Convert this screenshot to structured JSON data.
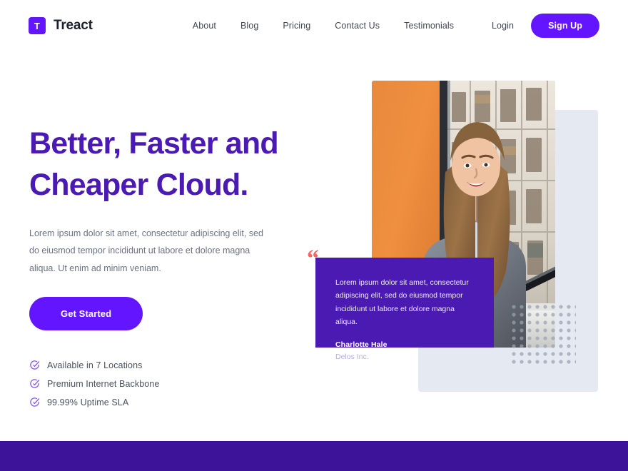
{
  "brand": {
    "mark_letter": "T",
    "name": "Treact"
  },
  "nav": {
    "links": [
      {
        "label": "About"
      },
      {
        "label": "Blog"
      },
      {
        "label": "Pricing"
      },
      {
        "label": "Contact Us"
      },
      {
        "label": "Testimonials"
      }
    ],
    "login_label": "Login",
    "signup_label": "Sign Up"
  },
  "hero": {
    "title_line1": "Better, Faster and",
    "title_line2": "Cheaper Cloud.",
    "description": "Lorem ipsum dolor sit amet, consectetur adipiscing elit, sed do eiusmod tempor incididunt ut labore et dolore magna aliqua. Ut enim ad minim veniam.",
    "cta_label": "Get Started",
    "features": [
      {
        "label": "Available in 7 Locations"
      },
      {
        "label": "Premium Internet Backbone"
      },
      {
        "label": "99.99% Uptime SLA"
      }
    ]
  },
  "testimonial": {
    "quote_glyph": "“",
    "text": "Lorem ipsum dolor sit amet, consectetur adipiscing elit, sed do eiusmod tempor incididunt ut labore et dolore magna aliqua.",
    "author": "Charlotte Hale",
    "company": "Delos Inc."
  },
  "photo": {
    "alt": "Smiling woman in gray blazer standing by an office window"
  },
  "colors": {
    "primary_purple": "#6415ff",
    "heading_purple": "#4b1ab3",
    "panel_blue": "#e4e9f2",
    "quote_red": "#f56565",
    "band_purple": "#3d1499",
    "body_gray": "#6b7280"
  }
}
